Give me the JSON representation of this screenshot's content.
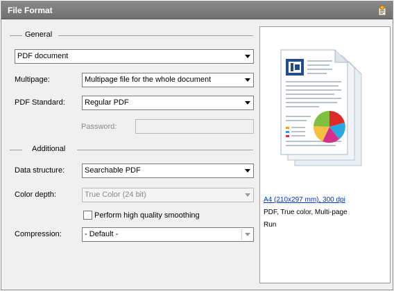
{
  "window": {
    "title": "File Format"
  },
  "sections": {
    "general": "General",
    "additional": "Additional"
  },
  "format": {
    "value": "PDF document"
  },
  "multipage": {
    "label": "Multipage:",
    "value": "Multipage file for the whole document"
  },
  "pdf_standard": {
    "label": "PDF Standard:",
    "value": "Regular PDF"
  },
  "password": {
    "label": "Password:",
    "value": ""
  },
  "data_structure": {
    "label": "Data structure:",
    "value": "Searchable PDF"
  },
  "color_depth": {
    "label": "Color depth:",
    "value": "True Color (24 bit)"
  },
  "smoothing": {
    "label": "Perform high quality smoothing",
    "checked": false
  },
  "compression": {
    "label": "Compression:",
    "value": "- Default -"
  },
  "preview": {
    "link": "A4 (210x297 mm), 300 dpi",
    "summary": "PDF, True color, Multi-page",
    "extra": "Run"
  },
  "icons": {
    "title": "settings-wizard-icon",
    "preview": "pdf-document-icon"
  },
  "colors": {
    "titlebar": "#7a7a7a",
    "link": "#0033cc",
    "background": "#f0f0f0"
  }
}
